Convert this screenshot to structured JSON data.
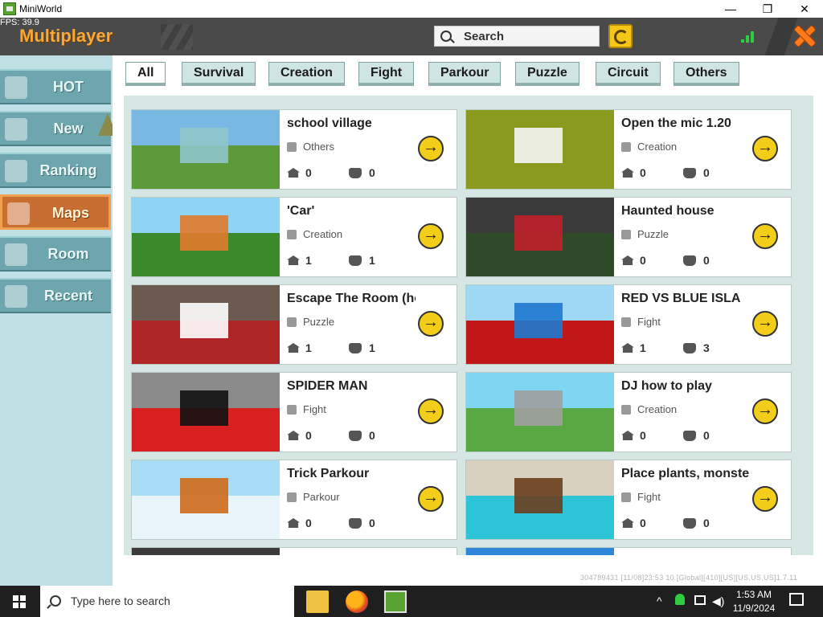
{
  "window": {
    "title": "MiniWorld",
    "minimize": "—",
    "maximize": "❐",
    "close": "✕"
  },
  "fps": "FPS: 39.9",
  "header": {
    "title": "Multiplayer",
    "search_label": "Search"
  },
  "sidebar": {
    "items": [
      {
        "label": "HOT"
      },
      {
        "label": "New"
      },
      {
        "label": "Ranking"
      },
      {
        "label": "Maps"
      },
      {
        "label": "Room"
      },
      {
        "label": "Recent"
      }
    ]
  },
  "filters": [
    "All",
    "Survival",
    "Creation",
    "Fight",
    "Parkour",
    "Puzzle",
    "Circuit",
    "Others"
  ],
  "maps": [
    {
      "name": "school village",
      "category": "Others",
      "homes": "0",
      "players": "0",
      "thumb": [
        "#7ab8e4",
        "#5d9b3a",
        "#8ec7c9"
      ]
    },
    {
      "name": "Open the mic 1.20",
      "category": "Creation",
      "homes": "0",
      "players": "0",
      "thumb": [
        "#8a9a1e",
        "#8a9a1e",
        "#f5f5f5"
      ]
    },
    {
      "name": "'Car'",
      "category": "Creation",
      "homes": "1",
      "players": "1",
      "thumb": [
        "#8fd3f5",
        "#3a8a2c",
        "#e07a2c"
      ]
    },
    {
      "name": "Haunted house",
      "category": "Puzzle",
      "homes": "0",
      "players": "0",
      "thumb": [
        "#3b3b3b",
        "#2f4a28",
        "#c0202a"
      ]
    },
    {
      "name": "Escape The Room (hor",
      "category": "Puzzle",
      "homes": "1",
      "players": "1",
      "thumb": [
        "#6a5a50",
        "#b02525",
        "#ffffff"
      ]
    },
    {
      "name": "RED VS BLUE ISLA",
      "category": "Fight",
      "homes": "1",
      "players": "3",
      "thumb": [
        "#9fd8f5",
        "#c01818",
        "#1e78d0"
      ]
    },
    {
      "name": "SPIDER MAN",
      "category": "Fight",
      "homes": "0",
      "players": "0",
      "thumb": [
        "#8a8a8a",
        "#d92020",
        "#111111"
      ]
    },
    {
      "name": "DJ how to play",
      "category": "Creation",
      "homes": "0",
      "players": "0",
      "thumb": [
        "#7fd6f2",
        "#5aa843",
        "#a0a0a0"
      ]
    },
    {
      "name": "Trick Parkour",
      "category": "Parkour",
      "homes": "0",
      "players": "0",
      "thumb": [
        "#a8dcf7",
        "#e8f5fb",
        "#d06a1a"
      ]
    },
    {
      "name": "Place plants, monsters",
      "category": "Fight",
      "homes": "0",
      "players": "0",
      "thumb": [
        "#d8d0c0",
        "#2ec4d8",
        "#6b3f1e"
      ]
    }
  ],
  "footer_id": "304789431 [11/08]23:53 10 [Global][410][US][US,US,US]1.7.11",
  "taskbar": {
    "search_placeholder": "Type here to search",
    "time": "1:53 AM",
    "date": "11/9/2024"
  }
}
